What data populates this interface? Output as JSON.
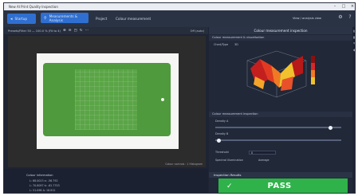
{
  "window": {
    "title": "New AI Print Quality Inspection"
  },
  "menubar": {
    "back_label": "Startup",
    "active_tab_label": "Measurements & Analysis",
    "tab2_label": "Project",
    "tab3_label": "Colour measurement",
    "right_text": "View / analysis view"
  },
  "left_toolbar": {
    "left_text": "Presets/Filter 50 — 100.0 %  (Fit to 4)",
    "right_text": "Off  (auto)"
  },
  "viewer": {
    "status_text": "Colour controls : 1 Histogram"
  },
  "info_panel": {
    "title": "Colour information",
    "lines": [
      "L: 68.0013  a: -56.792",
      "L: 70.8097  b: -62.7703",
      "L: 51.098  Δ: 18.812"
    ]
  },
  "right_panel": {
    "header": "Colour measurement inspection",
    "sub_header": "Colour measurement & visualisation",
    "dropdown_label": "Chart/Type",
    "dropdown_value": "3D",
    "section2": "Colour measurement inspection",
    "slider1_label": "Density A",
    "slider2_label": "Density B",
    "field1_label": "Threshold",
    "field1_value": "0",
    "field2_label": "Spectral illumination",
    "field2_value": "Average",
    "results_header": "Inspection Results",
    "pass_text": "PASS"
  },
  "colors": {
    "accent": "#2f6fd1",
    "pass": "#2fb24a",
    "plot_hot": "#d8282a",
    "plot_warm": "#f2c12e"
  }
}
